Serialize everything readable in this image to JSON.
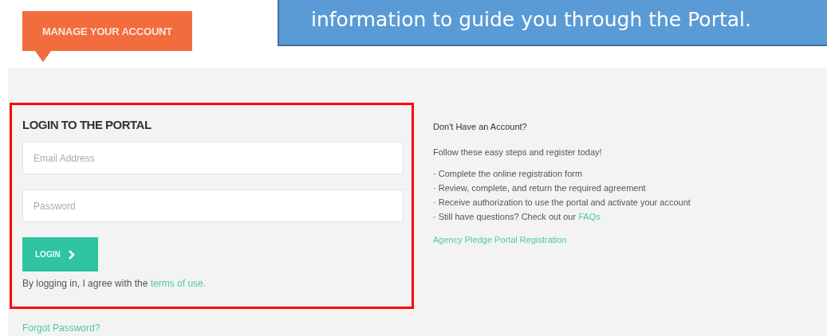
{
  "callout": {
    "text": "information to guide you through the Portal."
  },
  "logo": {
    "text": "MANAGE YOUR ACCOUNT"
  },
  "login": {
    "title": "LOGIN TO THE PORTAL",
    "fields": [
      {
        "placeholder": "Email Address"
      },
      {
        "placeholder": "Password"
      }
    ],
    "button": "LOGIN",
    "terms": {
      "text": "By logging in, I agree with the ",
      "link": "terms of use."
    }
  },
  "forgot_link": "Forgot Password?",
  "register": {
    "title": "Don't Have an Account?",
    "intro": "Follow these easy steps and register today!",
    "steps": [
      {
        "text": "· Complete the online registration form"
      },
      {
        "text": "· Review, complete, and return the required agreement"
      },
      {
        "text": "· Receive authorization to use the portal and activate your account"
      },
      {
        "text": "· Still have questions? Check out our ",
        "link": "FAQs"
      }
    ],
    "link": "Agency Pledge Portal Registration"
  }
}
